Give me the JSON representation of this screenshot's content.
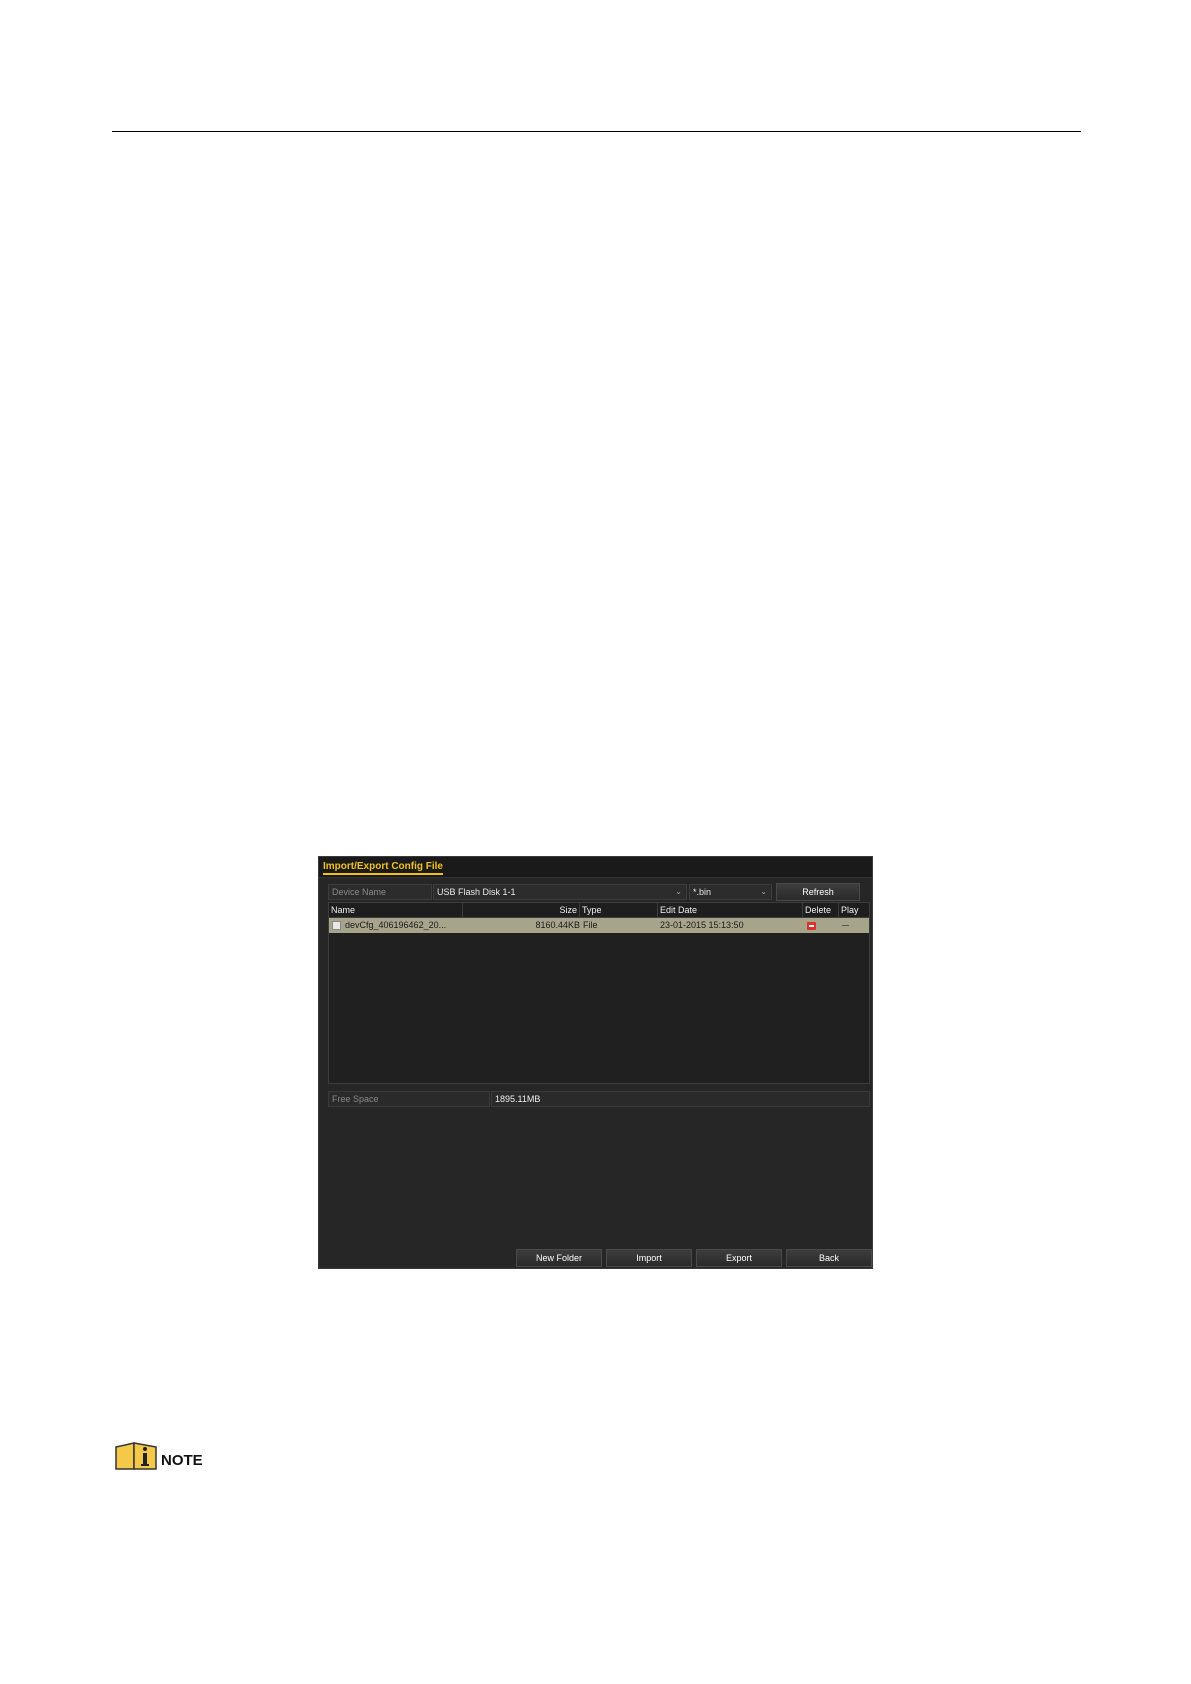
{
  "dialog": {
    "title": "Import/Export Config File",
    "device_name_label": "Device Name",
    "device_name_value": "USB Flash Disk 1-1",
    "filter_value": "*.bin",
    "refresh_label": "Refresh",
    "columns": [
      "Name",
      "Size",
      "Type",
      "Edit Date",
      "Delete",
      "Play"
    ],
    "files": [
      {
        "name": "devCfg_406196462_20...",
        "size": "8160.44KB",
        "type": "File",
        "edit_date": "23-01-2015 15:13:50"
      }
    ],
    "free_space_label": "Free Space",
    "free_space_value": "1895.11MB",
    "buttons": {
      "new_folder": "New Folder",
      "import": "Import",
      "export": "Export",
      "back": "Back"
    }
  },
  "note": {
    "label": "NOTE"
  },
  "colors": {
    "accent": "#f2c21b",
    "panel": "#262626",
    "selected_row": "#a8a48c",
    "delete_icon": "#d8332a"
  }
}
